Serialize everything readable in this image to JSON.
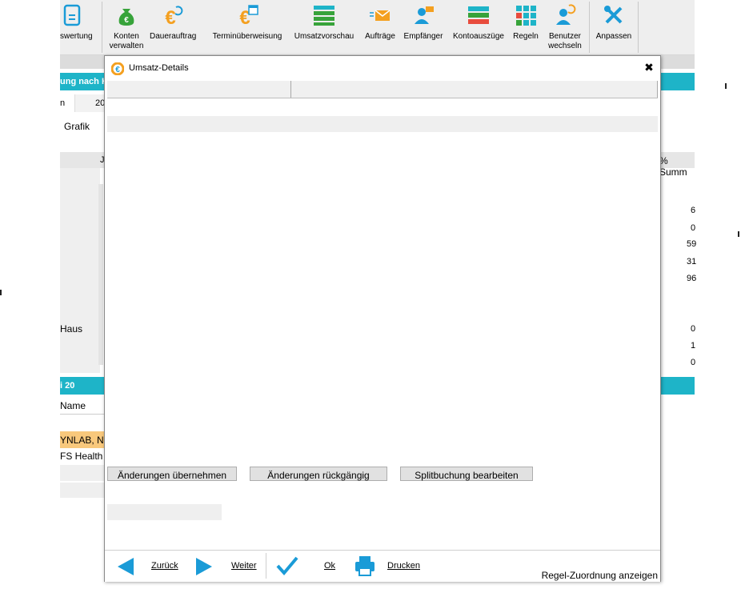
{
  "toolbar": {
    "items": [
      {
        "label": "swertung",
        "icon": "document-icon"
      },
      {
        "label": "Konten\nverwalten",
        "icon": "money-bag-icon"
      },
      {
        "label": "Dauerauftrag",
        "icon": "euro-recurring-icon"
      },
      {
        "label": "Terminüberweisung",
        "icon": "euro-calendar-icon"
      },
      {
        "label": "Umsatzvorschau",
        "icon": "list-preview-icon"
      },
      {
        "label": "Aufträge",
        "icon": "envelope-icon"
      },
      {
        "label": "Empfänger",
        "icon": "recipient-icon"
      },
      {
        "label": "Kontoauszüge",
        "icon": "statements-icon"
      },
      {
        "label": "Regeln",
        "icon": "rules-grid-icon"
      },
      {
        "label": "Benutzer\nwechseln",
        "icon": "switch-user-icon"
      },
      {
        "label": "Anpassen",
        "icon": "tools-icon"
      }
    ]
  },
  "background": {
    "section_title": "ung nach K",
    "filter_label": "n",
    "filter_year": "20",
    "tab_grafik": "Grafik",
    "col_j": "J",
    "col_summe": "% Summ",
    "row_haus": "Haus",
    "values": [
      "6",
      "0",
      "59",
      "31",
      "96",
      "0",
      "1",
      "0"
    ],
    "section2_title": "i 20",
    "col_name": "Name",
    "row1": "YNLAB, N",
    "row2": "FS Health"
  },
  "dialog": {
    "title": "Umsatz-Details",
    "close_symbol": "✖",
    "buttons": {
      "apply": "Änderungen übernehmen",
      "undo": "Änderungen rückgängig",
      "split": "Splitbuchung bearbeiten"
    },
    "nav": {
      "back": "Zurück",
      "next": "Weiter",
      "ok": "Ok",
      "print": "Drucken"
    },
    "rule_link": "Regel-Zuordnung anzeigen"
  },
  "colors": {
    "teal": "#1eb4c8",
    "nav_blue": "#1a9bd7",
    "orange": "#f4a020",
    "green": "#37a33a",
    "highlight_row": "#f8c87c"
  }
}
